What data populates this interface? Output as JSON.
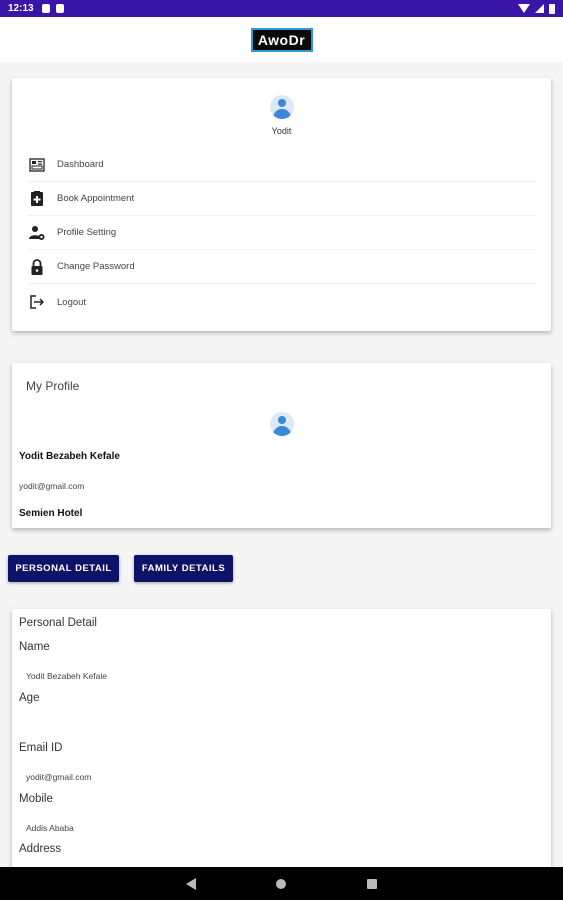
{
  "status_bar": {
    "time": "12:13"
  },
  "app_bar": {
    "logo_text": "AwoDr"
  },
  "menu": {
    "user_name": "Yodit",
    "items": [
      {
        "label": "Dashboard",
        "icon": "dashboard-icon"
      },
      {
        "label": "Book Appointment",
        "icon": "book-appointment-icon"
      },
      {
        "label": "Profile Setting",
        "icon": "profile-setting-icon"
      },
      {
        "label": "Change Password",
        "icon": "lock-icon"
      },
      {
        "label": "Logout",
        "icon": "logout-icon"
      }
    ]
  },
  "profile": {
    "title": "My Profile",
    "full_name": "Yodit Bezabeh Kefale",
    "email": "yodit@gmail.com",
    "company": "Semien Hotel"
  },
  "tabs": {
    "personal": "PERSONAL DETAIL",
    "family": "FAMILY DETAILS"
  },
  "personal_detail": {
    "title": "Personal Detail",
    "name_label": "Name",
    "name_value": "Yodit Bezabeh Kefale",
    "age_label": "Age",
    "email_label": "Email ID",
    "email_value": "yodit@gmail.com",
    "mobile_label": "Mobile",
    "mobile_value": "Addis Ababa",
    "address_label": "Address"
  },
  "colors": {
    "status_bar": "#3a16a8",
    "button": "#0d1467",
    "avatar": "#3b87d9"
  }
}
